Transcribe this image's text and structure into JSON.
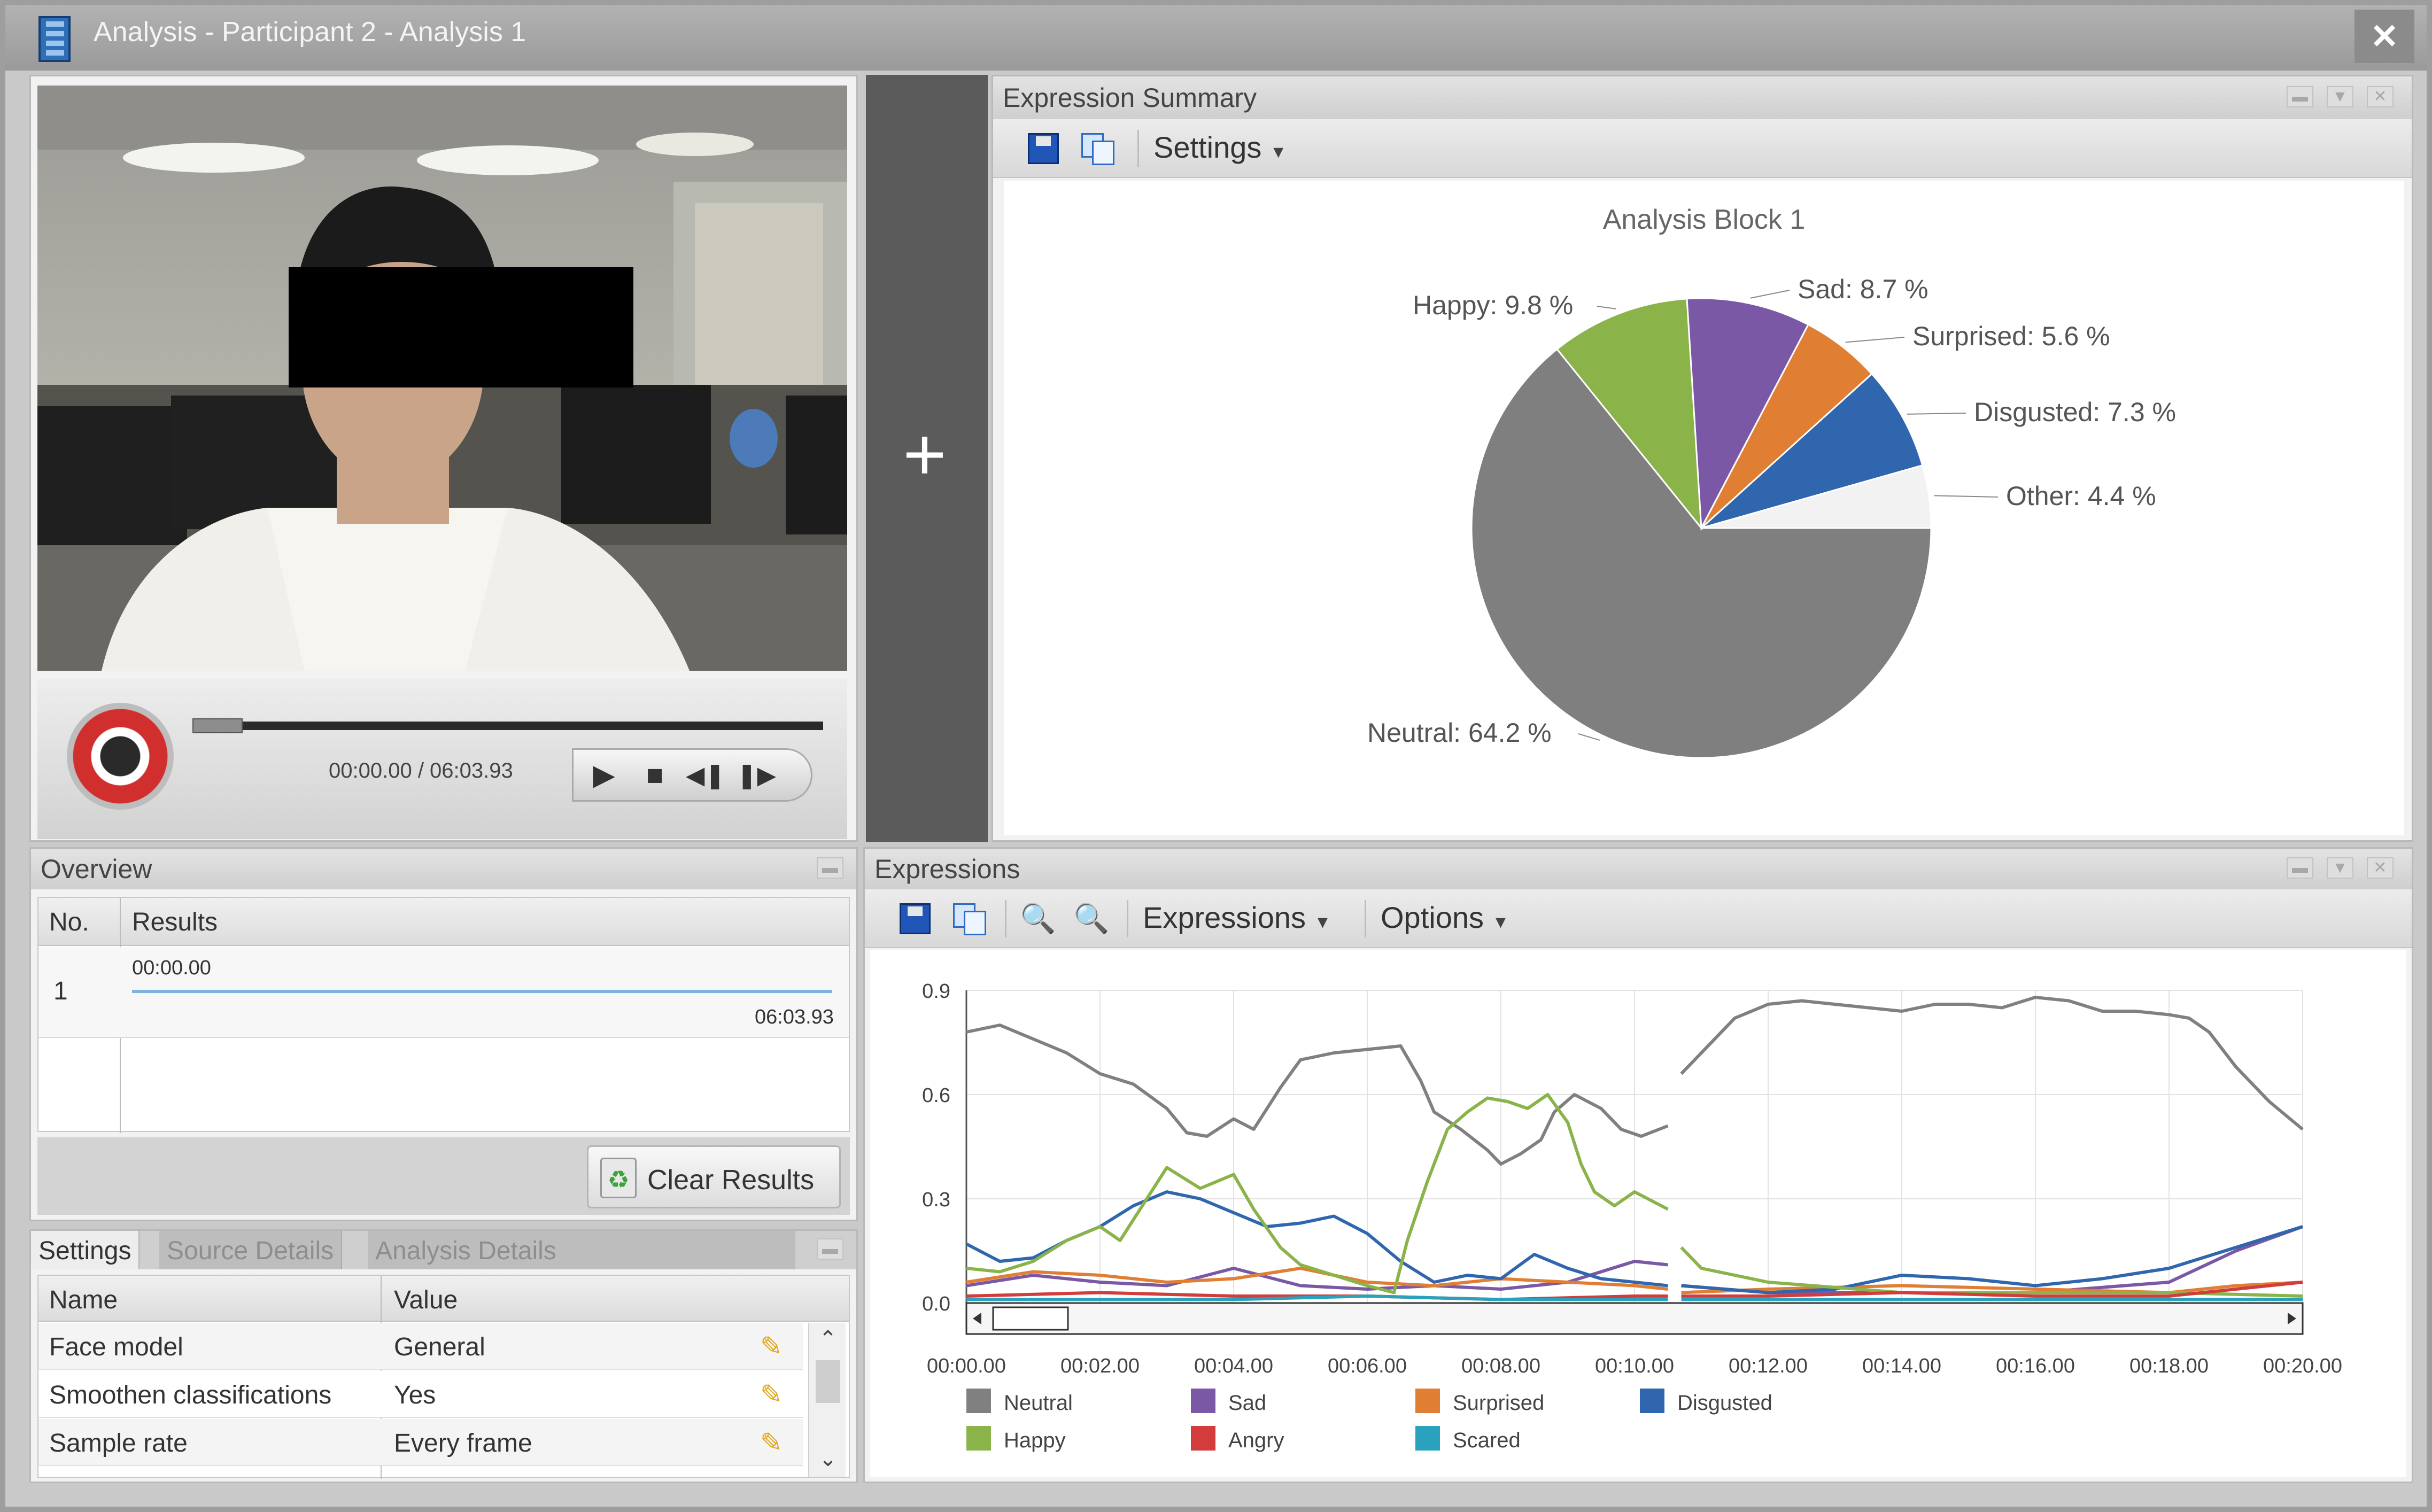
{
  "window": {
    "title": "Analysis - Participant 2 - Analysis 1",
    "close_glyph": "✕"
  },
  "player": {
    "time": "00:00.00 / 06:03.93",
    "progress": 0.08,
    "icons": [
      "record-icon",
      "play-icon",
      "stop-icon",
      "step-back-icon",
      "step-forward-icon"
    ]
  },
  "summary": {
    "panel_title": "Expression Summary",
    "settings_label": "Settings",
    "chart_data": {
      "type": "pie",
      "title": "Analysis Block 1",
      "slices": [
        {
          "label": "Neutral: 64.2 %",
          "name": "Neutral",
          "value": 64.2,
          "color": "#7f7f7f"
        },
        {
          "label": "Happy: 9.8 %",
          "name": "Happy",
          "value": 9.8,
          "color": "#8ab34a"
        },
        {
          "label": "Sad: 8.7 %",
          "name": "Sad",
          "value": 8.7,
          "color": "#7b58a6"
        },
        {
          "label": "Surprised: 5.6 %",
          "name": "Surprised",
          "value": 5.6,
          "color": "#e07f33"
        },
        {
          "label": "Disgusted: 7.3 %",
          "name": "Disgusted",
          "value": 7.3,
          "color": "#2f66ad"
        },
        {
          "label": "Other: 4.4 %",
          "name": "Other",
          "value": 4.4,
          "color": "#f2f2f2"
        }
      ]
    }
  },
  "overview": {
    "panel_title": "Overview",
    "col_no": "No.",
    "col_results": "Results",
    "row_no": "1",
    "row_start": "00:00.00",
    "row_end": "06:03.93",
    "clear_label": "Clear Results"
  },
  "settings": {
    "tabs": [
      "Settings",
      "Source Details",
      "Analysis Details"
    ],
    "col_name": "Name",
    "col_value": "Value",
    "rows": [
      {
        "name": "Face model",
        "value": "General"
      },
      {
        "name": "Smoothen classifications",
        "value": "Yes"
      },
      {
        "name": "Sample rate",
        "value": "Every frame"
      }
    ]
  },
  "expressions": {
    "panel_title": "Expressions",
    "menu_expressions": "Expressions",
    "menu_options": "Options",
    "chart_data": {
      "type": "line",
      "xlabel": "",
      "ylabel": "",
      "x_ticks": [
        "00:00.00",
        "00:02.00",
        "00:04.00",
        "00:06.00",
        "00:08.00",
        "00:10.00",
        "00:12.00",
        "00:14.00",
        "00:16.00",
        "00:18.00",
        "00:20.00"
      ],
      "y_ticks": [
        "0.0",
        "0.3",
        "0.6",
        "0.9"
      ],
      "xlim": [
        0,
        20
      ],
      "ylim": [
        0,
        0.9
      ],
      "grid": true,
      "legend_position": "bottom",
      "series": [
        {
          "name": "Neutral",
          "color": "#808080",
          "points": [
            [
              0,
              0.78
            ],
            [
              0.5,
              0.8
            ],
            [
              1,
              0.76
            ],
            [
              1.5,
              0.72
            ],
            [
              2,
              0.66
            ],
            [
              2.5,
              0.63
            ],
            [
              3,
              0.56
            ],
            [
              3.3,
              0.49
            ],
            [
              3.6,
              0.48
            ],
            [
              4,
              0.53
            ],
            [
              4.3,
              0.5
            ],
            [
              4.7,
              0.62
            ],
            [
              5,
              0.7
            ],
            [
              5.5,
              0.72
            ],
            [
              6,
              0.73
            ],
            [
              6.5,
              0.74
            ],
            [
              6.8,
              0.64
            ],
            [
              7,
              0.55
            ],
            [
              7.4,
              0.5
            ],
            [
              7.8,
              0.44
            ],
            [
              8,
              0.4
            ],
            [
              8.3,
              0.43
            ],
            [
              8.6,
              0.47
            ],
            [
              8.8,
              0.55
            ],
            [
              9.1,
              0.6
            ],
            [
              9.5,
              0.56
            ],
            [
              9.8,
              0.5
            ],
            [
              10.1,
              0.48
            ],
            [
              10.5,
              0.51
            ],
            [
              null,
              null
            ],
            [
              10.7,
              0.66
            ],
            [
              11,
              0.72
            ],
            [
              11.5,
              0.82
            ],
            [
              12,
              0.86
            ],
            [
              12.5,
              0.87
            ],
            [
              13,
              0.86
            ],
            [
              13.5,
              0.85
            ],
            [
              14,
              0.84
            ],
            [
              14.5,
              0.86
            ],
            [
              15,
              0.86
            ],
            [
              15.5,
              0.85
            ],
            [
              16,
              0.88
            ],
            [
              16.5,
              0.87
            ],
            [
              17,
              0.84
            ],
            [
              17.5,
              0.84
            ],
            [
              18,
              0.83
            ],
            [
              18.3,
              0.82
            ],
            [
              18.6,
              0.78
            ],
            [
              19,
              0.68
            ],
            [
              19.5,
              0.58
            ],
            [
              20,
              0.5
            ]
          ]
        },
        {
          "name": "Sad",
          "color": "#7b58a6",
          "points": [
            [
              0,
              0.05
            ],
            [
              1,
              0.08
            ],
            [
              2,
              0.06
            ],
            [
              3,
              0.05
            ],
            [
              4,
              0.1
            ],
            [
              5,
              0.05
            ],
            [
              6,
              0.04
            ],
            [
              7,
              0.05
            ],
            [
              8,
              0.04
            ],
            [
              9,
              0.06
            ],
            [
              10,
              0.12
            ],
            [
              10.5,
              0.11
            ],
            [
              null,
              null
            ],
            [
              10.7,
              0.05
            ],
            [
              12,
              0.03
            ],
            [
              14,
              0.03
            ],
            [
              16,
              0.03
            ],
            [
              18,
              0.06
            ],
            [
              19,
              0.15
            ],
            [
              20,
              0.22
            ]
          ]
        },
        {
          "name": "Surprised",
          "color": "#e07f33",
          "points": [
            [
              0,
              0.06
            ],
            [
              1,
              0.09
            ],
            [
              2,
              0.08
            ],
            [
              3,
              0.06
            ],
            [
              4,
              0.07
            ],
            [
              5,
              0.1
            ],
            [
              6,
              0.06
            ],
            [
              7,
              0.05
            ],
            [
              8,
              0.07
            ],
            [
              9,
              0.06
            ],
            [
              10,
              0.05
            ],
            [
              10.5,
              0.04
            ],
            [
              null,
              null
            ],
            [
              10.7,
              0.03
            ],
            [
              12,
              0.04
            ],
            [
              14,
              0.05
            ],
            [
              16,
              0.04
            ],
            [
              18,
              0.03
            ],
            [
              19,
              0.05
            ],
            [
              20,
              0.06
            ]
          ]
        },
        {
          "name": "Disgusted",
          "color": "#2f66ad",
          "points": [
            [
              0,
              0.17
            ],
            [
              0.5,
              0.12
            ],
            [
              1,
              0.13
            ],
            [
              1.5,
              0.18
            ],
            [
              2,
              0.22
            ],
            [
              2.5,
              0.28
            ],
            [
              3,
              0.32
            ],
            [
              3.5,
              0.3
            ],
            [
              4,
              0.26
            ],
            [
              4.5,
              0.22
            ],
            [
              5,
              0.23
            ],
            [
              5.5,
              0.25
            ],
            [
              6,
              0.2
            ],
            [
              6.5,
              0.12
            ],
            [
              7,
              0.06
            ],
            [
              7.5,
              0.08
            ],
            [
              8,
              0.07
            ],
            [
              8.5,
              0.14
            ],
            [
              9,
              0.1
            ],
            [
              9.5,
              0.07
            ],
            [
              10,
              0.06
            ],
            [
              10.5,
              0.05
            ],
            [
              null,
              null
            ],
            [
              10.7,
              0.05
            ],
            [
              12,
              0.03
            ],
            [
              13,
              0.04
            ],
            [
              14,
              0.08
            ],
            [
              15,
              0.07
            ],
            [
              16,
              0.05
            ],
            [
              17,
              0.07
            ],
            [
              18,
              0.1
            ],
            [
              19,
              0.16
            ],
            [
              20,
              0.22
            ]
          ]
        },
        {
          "name": "Happy",
          "color": "#8ab34a",
          "points": [
            [
              0,
              0.1
            ],
            [
              0.5,
              0.09
            ],
            [
              1,
              0.12
            ],
            [
              1.5,
              0.18
            ],
            [
              2,
              0.22
            ],
            [
              2.3,
              0.18
            ],
            [
              2.5,
              0.24
            ],
            [
              3,
              0.39
            ],
            [
              3.5,
              0.33
            ],
            [
              4,
              0.37
            ],
            [
              4.3,
              0.27
            ],
            [
              4.7,
              0.16
            ],
            [
              5,
              0.11
            ],
            [
              5.5,
              0.08
            ],
            [
              6,
              0.05
            ],
            [
              6.4,
              0.03
            ],
            [
              6.6,
              0.18
            ],
            [
              6.9,
              0.35
            ],
            [
              7.2,
              0.5
            ],
            [
              7.5,
              0.55
            ],
            [
              7.8,
              0.59
            ],
            [
              8.1,
              0.58
            ],
            [
              8.4,
              0.56
            ],
            [
              8.7,
              0.6
            ],
            [
              9,
              0.52
            ],
            [
              9.2,
              0.4
            ],
            [
              9.4,
              0.32
            ],
            [
              9.7,
              0.28
            ],
            [
              10,
              0.32
            ],
            [
              10.3,
              0.29
            ],
            [
              10.5,
              0.27
            ],
            [
              null,
              null
            ],
            [
              10.7,
              0.16
            ],
            [
              11,
              0.1
            ],
            [
              12,
              0.06
            ],
            [
              14,
              0.03
            ],
            [
              16,
              0.03
            ],
            [
              18,
              0.03
            ],
            [
              20,
              0.02
            ]
          ]
        },
        {
          "name": "Angry",
          "color": "#d23c3c",
          "points": [
            [
              0,
              0.02
            ],
            [
              2,
              0.03
            ],
            [
              4,
              0.02
            ],
            [
              6,
              0.02
            ],
            [
              8,
              0.01
            ],
            [
              10,
              0.02
            ],
            [
              10.5,
              0.02
            ],
            [
              null,
              null
            ],
            [
              10.7,
              0.02
            ],
            [
              12,
              0.02
            ],
            [
              14,
              0.03
            ],
            [
              16,
              0.02
            ],
            [
              18,
              0.02
            ],
            [
              19,
              0.04
            ],
            [
              20,
              0.06
            ]
          ]
        },
        {
          "name": "Scared",
          "color": "#2aa1bd",
          "points": [
            [
              0,
              0.01
            ],
            [
              2,
              0.01
            ],
            [
              4,
              0.01
            ],
            [
              6,
              0.02
            ],
            [
              8,
              0.01
            ],
            [
              10,
              0.01
            ],
            [
              10.5,
              0.01
            ],
            [
              null,
              null
            ],
            [
              10.7,
              0.01
            ],
            [
              12,
              0.01
            ],
            [
              14,
              0.01
            ],
            [
              16,
              0.01
            ],
            [
              18,
              0.01
            ],
            [
              20,
              0.01
            ]
          ]
        }
      ]
    }
  }
}
